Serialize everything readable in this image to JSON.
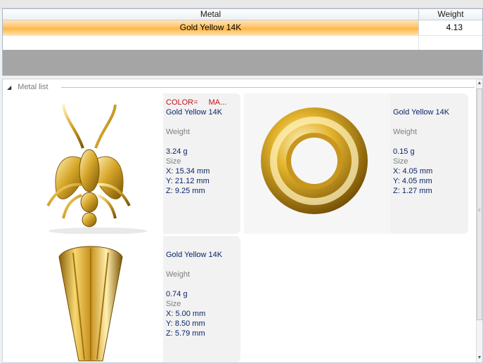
{
  "grid": {
    "columns": [
      "Metal",
      "Weight"
    ],
    "rows": [
      {
        "metal": "Gold Yellow 14K",
        "weight": "4.13"
      }
    ]
  },
  "metal_list": {
    "title": "Metal list",
    "items": [
      {
        "color_label": "COLOR=",
        "color_extra": "MA...",
        "metal": "Gold Yellow 14K",
        "weight_label": "Weight",
        "weight": "3.24 g",
        "size_label": "Size",
        "x": "X: 15.34 mm",
        "y": "Y: 21.12 mm",
        "z": "Z: 9.25 mm",
        "image": "fly-pendant"
      },
      {
        "metal": "Gold Yellow 14K",
        "weight_label": "Weight",
        "weight": "0.15 g",
        "size_label": "Size",
        "x": "X: 4.05 mm",
        "y": "Y: 4.05 mm",
        "z": "Z: 1.27 mm",
        "image": "gold-ring"
      },
      {
        "metal": "Gold Yellow 14K",
        "weight_label": "Weight",
        "weight": "0.74 g",
        "size_label": "Size",
        "x": "X: 5.00 mm",
        "y": "Y: 8.50 mm",
        "z": "Z: 5.79 mm",
        "image": "fluted-bail"
      }
    ]
  },
  "colors": {
    "selected_row": "#ffc46a",
    "gold": "#d9a820",
    "text_value": "#0a246a",
    "text_muted": "#808080",
    "color_label": "#c0101a"
  }
}
